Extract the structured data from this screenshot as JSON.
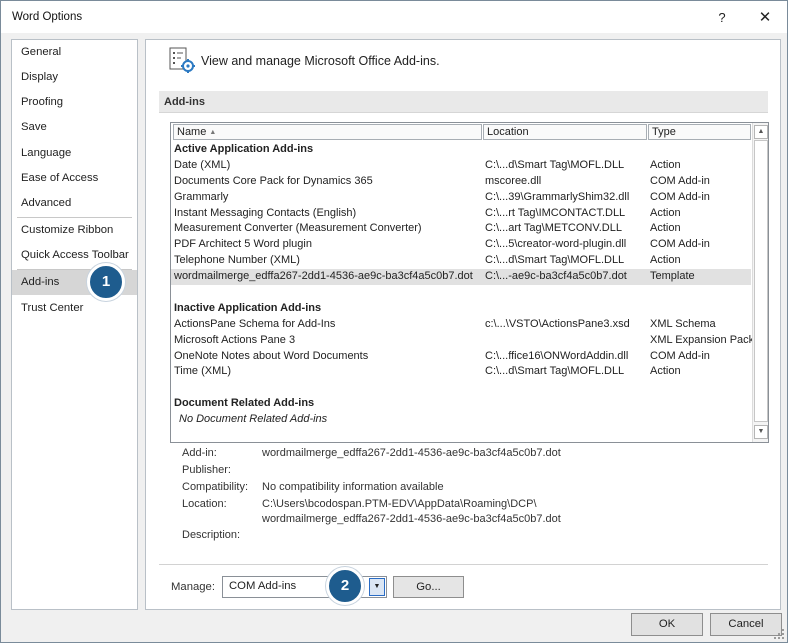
{
  "window": {
    "title": "Word Options",
    "help_label": "?",
    "close_label": "✕"
  },
  "sidebar": {
    "items": [
      {
        "label": "General"
      },
      {
        "label": "Display"
      },
      {
        "label": "Proofing"
      },
      {
        "label": "Save"
      },
      {
        "label": "Language"
      },
      {
        "label": "Ease of Access"
      },
      {
        "label": "Advanced"
      },
      {
        "label": "Customize Ribbon"
      },
      {
        "label": "Quick Access Toolbar"
      },
      {
        "label": "Add-ins",
        "selected": true
      },
      {
        "label": "Trust Center"
      }
    ]
  },
  "header": {
    "icon": "addins-gear-icon",
    "text": "View and manage Microsoft Office Add-ins."
  },
  "section": {
    "title": "Add-ins"
  },
  "list": {
    "columns": [
      "Name",
      "Location",
      "Type"
    ],
    "sort_indicator": "▲",
    "groups": [
      {
        "title": "Active Application Add-ins",
        "rows": [
          {
            "name": "Date (XML)",
            "location": "C:\\...d\\Smart Tag\\MOFL.DLL",
            "type": "Action"
          },
          {
            "name": "Documents Core Pack for Dynamics 365",
            "location": "mscoree.dll",
            "type": "COM Add-in"
          },
          {
            "name": "Grammarly",
            "location": "C:\\...39\\GrammarlyShim32.dll",
            "type": "COM Add-in"
          },
          {
            "name": "Instant Messaging Contacts (English)",
            "location": "C:\\...rt Tag\\IMCONTACT.DLL",
            "type": "Action"
          },
          {
            "name": "Measurement Converter (Measurement Converter)",
            "location": "C:\\...art Tag\\METCONV.DLL",
            "type": "Action"
          },
          {
            "name": "PDF Architect 5 Word plugin",
            "location": "C:\\...5\\creator-word-plugin.dll",
            "type": "COM Add-in"
          },
          {
            "name": "Telephone Number (XML)",
            "location": "C:\\...d\\Smart Tag\\MOFL.DLL",
            "type": "Action"
          },
          {
            "name": "wordmailmerge_edffa267-2dd1-4536-ae9c-ba3cf4a5c0b7.dot",
            "location": "C:\\...-ae9c-ba3cf4a5c0b7.dot",
            "type": "Template",
            "selected": true
          }
        ]
      },
      {
        "title": "Inactive Application Add-ins",
        "rows": [
          {
            "name": "ActionsPane Schema for Add-Ins",
            "location": "c:\\...\\VSTO\\ActionsPane3.xsd",
            "type": "XML Schema"
          },
          {
            "name": "Microsoft Actions Pane 3",
            "location": "",
            "type": "XML Expansion Pack"
          },
          {
            "name": "OneNote Notes about Word Documents",
            "location": "C:\\...ffice16\\ONWordAddin.dll",
            "type": "COM Add-in"
          },
          {
            "name": "Time (XML)",
            "location": "C:\\...d\\Smart Tag\\MOFL.DLL",
            "type": "Action"
          }
        ]
      },
      {
        "title": "Document Related Add-ins",
        "empty_message": "No Document Related Add-ins"
      }
    ]
  },
  "details": {
    "addin_label": "Add-in:",
    "addin_value": "wordmailmerge_edffa267-2dd1-4536-ae9c-ba3cf4a5c0b7.dot",
    "publisher_label": "Publisher:",
    "publisher_value": "",
    "compat_label": "Compatibility:",
    "compat_value": "No compatibility information available",
    "location_label": "Location:",
    "location_line1": "C:\\Users\\bcodospan.PTM-EDV\\AppData\\Roaming\\DCP\\",
    "location_line2": "wordmailmerge_edffa267-2dd1-4536-ae9c-ba3cf4a5c0b7.dot",
    "description_label": "Description:",
    "description_value": ""
  },
  "manage": {
    "label": "Manage:",
    "selected": "COM Add-ins",
    "go_label": "Go..."
  },
  "buttons": {
    "ok": "OK",
    "cancel": "Cancel"
  },
  "markers": [
    "1",
    "2"
  ],
  "colors": {
    "marker": "#1e5c8e",
    "selection": "#d6d6d6",
    "dropdown_focus": "#2a6cc5"
  }
}
